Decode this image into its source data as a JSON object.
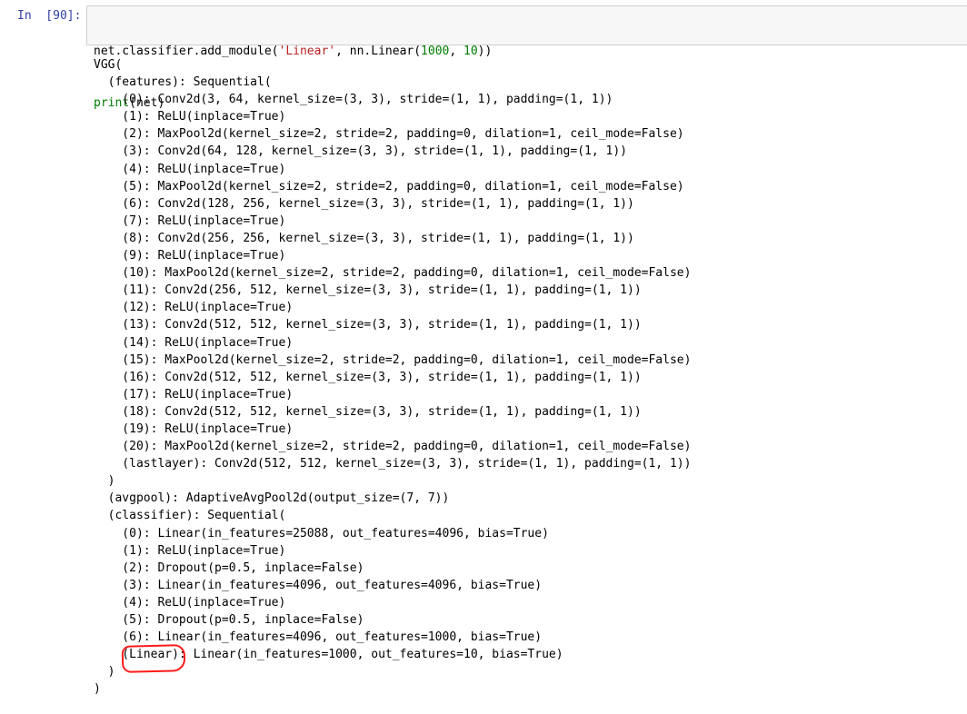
{
  "cell": {
    "prompt": "In  [90]:",
    "input": {
      "line1": {
        "a": "net.classifier.add_module(",
        "b": "'Linear'",
        "c": ", nn.Linear(",
        "d": "1000",
        "e": ", ",
        "f": "10",
        "g": "))"
      },
      "line2": {
        "a": "print",
        "b": "(net)"
      }
    },
    "output_lines": [
      "VGG(",
      "  (features): Sequential(",
      "    (0): Conv2d(3, 64, kernel_size=(3, 3), stride=(1, 1), padding=(1, 1))",
      "    (1): ReLU(inplace=True)",
      "    (2): MaxPool2d(kernel_size=2, stride=2, padding=0, dilation=1, ceil_mode=False)",
      "    (3): Conv2d(64, 128, kernel_size=(3, 3), stride=(1, 1), padding=(1, 1))",
      "    (4): ReLU(inplace=True)",
      "    (5): MaxPool2d(kernel_size=2, stride=2, padding=0, dilation=1, ceil_mode=False)",
      "    (6): Conv2d(128, 256, kernel_size=(3, 3), stride=(1, 1), padding=(1, 1))",
      "    (7): ReLU(inplace=True)",
      "    (8): Conv2d(256, 256, kernel_size=(3, 3), stride=(1, 1), padding=(1, 1))",
      "    (9): ReLU(inplace=True)",
      "    (10): MaxPool2d(kernel_size=2, stride=2, padding=0, dilation=1, ceil_mode=False)",
      "    (11): Conv2d(256, 512, kernel_size=(3, 3), stride=(1, 1), padding=(1, 1))",
      "    (12): ReLU(inplace=True)",
      "    (13): Conv2d(512, 512, kernel_size=(3, 3), stride=(1, 1), padding=(1, 1))",
      "    (14): ReLU(inplace=True)",
      "    (15): MaxPool2d(kernel_size=2, stride=2, padding=0, dilation=1, ceil_mode=False)",
      "    (16): Conv2d(512, 512, kernel_size=(3, 3), stride=(1, 1), padding=(1, 1))",
      "    (17): ReLU(inplace=True)",
      "    (18): Conv2d(512, 512, kernel_size=(3, 3), stride=(1, 1), padding=(1, 1))",
      "    (19): ReLU(inplace=True)",
      "    (20): MaxPool2d(kernel_size=2, stride=2, padding=0, dilation=1, ceil_mode=False)",
      "    (lastlayer): Conv2d(512, 512, kernel_size=(3, 3), stride=(1, 1), padding=(1, 1))",
      "  )",
      "  (avgpool): AdaptiveAvgPool2d(output_size=(7, 7))",
      "  (classifier): Sequential(",
      "    (0): Linear(in_features=25088, out_features=4096, bias=True)",
      "    (1): ReLU(inplace=True)",
      "    (2): Dropout(p=0.5, inplace=False)",
      "    (3): Linear(in_features=4096, out_features=4096, bias=True)",
      "    (4): ReLU(inplace=True)",
      "    (5): Dropout(p=0.5, inplace=False)",
      "    (6): Linear(in_features=4096, out_features=1000, bias=True)",
      "    (Linear): Linear(in_features=1000, out_features=10, bias=True)",
      "  )",
      ")"
    ]
  },
  "colors": {
    "prompt": "#303f9f",
    "input_background": "#f7f7f7",
    "input_border": "#cfcfcf",
    "string": "#ba2121",
    "number": "#008000",
    "builtin": "#008000",
    "annotation": "#ff1a1a"
  }
}
